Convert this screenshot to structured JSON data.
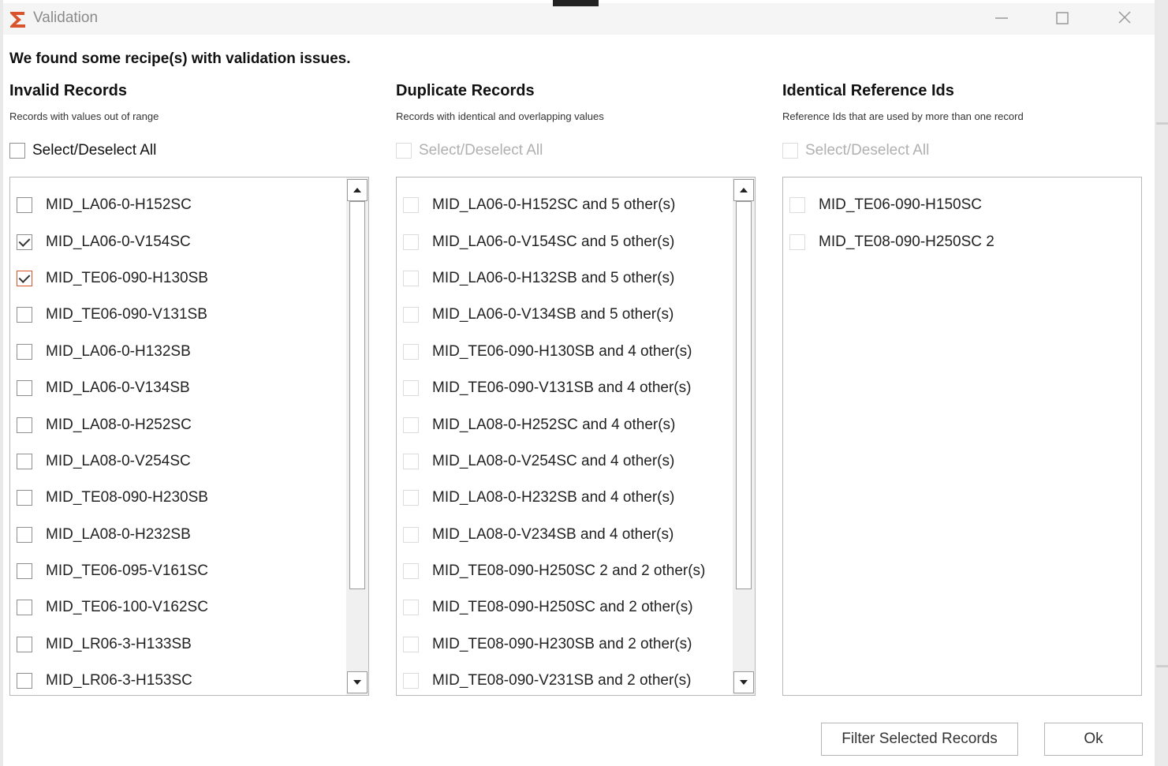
{
  "window": {
    "title": "Validation"
  },
  "dialog": {
    "heading": "We found some recipe(s) with validation issues."
  },
  "columns": [
    {
      "title": "Invalid Records",
      "subtitle": "Records with values out of range",
      "select_all_label": "Select/Deselect All",
      "select_all_checked": false,
      "select_all_enabled": true,
      "items": [
        {
          "label": "MID_LA06-0-H152SC",
          "checked": false
        },
        {
          "label": "MID_LA06-0-V154SC",
          "checked": true
        },
        {
          "label": "MID_TE06-090-H130SB",
          "checked": true,
          "focused": true
        },
        {
          "label": "MID_TE06-090-V131SB",
          "checked": false
        },
        {
          "label": "MID_LA06-0-H132SB",
          "checked": false
        },
        {
          "label": "MID_LA06-0-V134SB",
          "checked": false
        },
        {
          "label": "MID_LA08-0-H252SC",
          "checked": false
        },
        {
          "label": "MID_LA08-0-V254SC",
          "checked": false
        },
        {
          "label": "MID_TE08-090-H230SB",
          "checked": false
        },
        {
          "label": "MID_LA08-0-H232SB",
          "checked": false
        },
        {
          "label": "MID_TE06-095-V161SC",
          "checked": false
        },
        {
          "label": "MID_TE06-100-V162SC",
          "checked": false
        },
        {
          "label": "MID_LR06-3-H133SB",
          "checked": false
        },
        {
          "label": "MID_LR06-3-H153SC",
          "checked": false
        }
      ]
    },
    {
      "title": "Duplicate Records",
      "subtitle": "Records with identical and overlapping values",
      "select_all_label": "Select/Deselect All",
      "select_all_checked": false,
      "select_all_enabled": false,
      "items": [
        {
          "label": "MID_LA06-0-H152SC and 5 other(s)",
          "checked": false
        },
        {
          "label": "MID_LA06-0-V154SC and 5 other(s)",
          "checked": false
        },
        {
          "label": "MID_LA06-0-H132SB and 5 other(s)",
          "checked": false
        },
        {
          "label": "MID_LA06-0-V134SB and 5 other(s)",
          "checked": false
        },
        {
          "label": "MID_TE06-090-H130SB and 4 other(s)",
          "checked": false
        },
        {
          "label": "MID_TE06-090-V131SB and 4 other(s)",
          "checked": false
        },
        {
          "label": "MID_LA08-0-H252SC and 4 other(s)",
          "checked": false
        },
        {
          "label": "MID_LA08-0-V254SC and 4 other(s)",
          "checked": false
        },
        {
          "label": "MID_LA08-0-H232SB and 4 other(s)",
          "checked": false
        },
        {
          "label": "MID_LA08-0-V234SB and 4 other(s)",
          "checked": false
        },
        {
          "label": "MID_TE08-090-H250SC 2 and 2 other(s)",
          "checked": false
        },
        {
          "label": "MID_TE08-090-H250SC and 2 other(s)",
          "checked": false
        },
        {
          "label": "MID_TE08-090-H230SB and 2 other(s)",
          "checked": false
        },
        {
          "label": "MID_TE08-090-V231SB and 2 other(s)",
          "checked": false
        }
      ]
    },
    {
      "title": "Identical Reference Ids",
      "subtitle": "Reference Ids that are used by more than one record",
      "select_all_label": "Select/Deselect All",
      "select_all_checked": false,
      "select_all_enabled": false,
      "items": [
        {
          "label": "MID_TE06-090-H150SC",
          "checked": false
        },
        {
          "label": "MID_TE08-090-H250SC 2",
          "checked": false
        }
      ]
    }
  ],
  "buttons": {
    "filter_label": "Filter Selected Records",
    "ok_label": "Ok"
  },
  "colors": {
    "logo": "#d9542c",
    "focused_checkbox": "#d9542c"
  },
  "icons": {
    "logo": "app-logo-icon",
    "minimize": "minimize-icon",
    "maximize": "maximize-icon",
    "close": "close-icon",
    "scroll_up": "arrow-up-icon",
    "scroll_down": "arrow-down-icon"
  }
}
